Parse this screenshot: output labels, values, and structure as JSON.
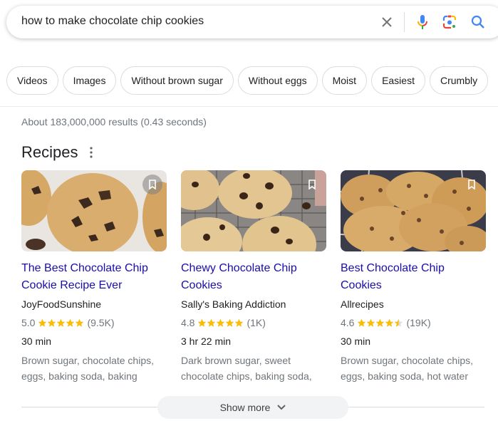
{
  "search": {
    "query": "how to make chocolate chip cookies",
    "clear_icon": "close-icon",
    "mic_icon": "microphone-icon",
    "lens_icon": "camera-lens-icon",
    "search_icon": "search-icon"
  },
  "chips": [
    {
      "label": "Videos"
    },
    {
      "label": "Images"
    },
    {
      "label": "Without brown sugar"
    },
    {
      "label": "Without eggs"
    },
    {
      "label": "Moist"
    },
    {
      "label": "Easiest"
    },
    {
      "label": "Crumbly"
    }
  ],
  "result_stats": "About 183,000,000 results (0.43 seconds)",
  "recipes": {
    "title": "Recipes",
    "menu_icon": "more-vert-icon",
    "cards": [
      {
        "title_line1": "The Best Chocolate Chip",
        "title_line2": "Cookie Recipe Ever",
        "source": "JoyFoodSunshine",
        "rating": "5.0",
        "stars": 5.0,
        "reviews": "(9.5K)",
        "time": "30 min",
        "ingredients_line1": "Brown sugar, chocolate chips,",
        "ingredients_line2": "eggs, baking soda, baking"
      },
      {
        "title_line1": "Chewy Chocolate Chip",
        "title_line2": "Cookies",
        "source": "Sally's Baking Addiction",
        "rating": "4.8",
        "stars": 4.8,
        "reviews": "(1K)",
        "time": "3 hr 22 min",
        "ingredients_line1": "Dark brown sugar, sweet",
        "ingredients_line2": "chocolate chips, baking soda,"
      },
      {
        "title_line1": "Best Chocolate Chip",
        "title_line2": "Cookies",
        "source": "Allrecipes",
        "rating": "4.6",
        "stars": 4.6,
        "reviews": "(19K)",
        "time": "30 min",
        "ingredients_line1": "Brown sugar, chocolate chips,",
        "ingredients_line2": "eggs, baking soda, hot water"
      }
    ]
  },
  "show_more": {
    "label": "Show more"
  },
  "colors": {
    "link": "#1a0dab",
    "star": "#fbbc04",
    "muted": "#70757a"
  }
}
